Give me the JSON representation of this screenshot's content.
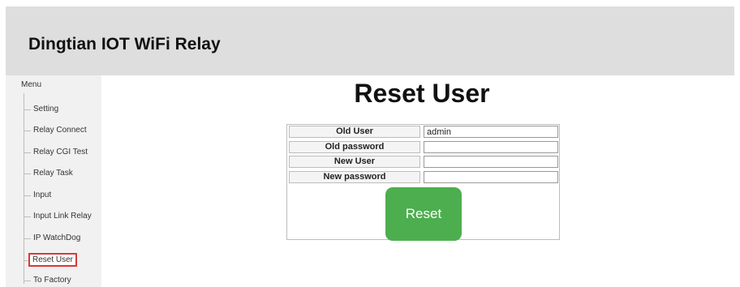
{
  "header": {
    "title": "Dingtian IOT WiFi Relay"
  },
  "sidebar": {
    "title": "Menu",
    "items": [
      {
        "label": "Setting"
      },
      {
        "label": "Relay Connect"
      },
      {
        "label": "Relay CGI Test"
      },
      {
        "label": "Relay Task"
      },
      {
        "label": "Input"
      },
      {
        "label": "Input Link Relay"
      },
      {
        "label": "IP WatchDog"
      },
      {
        "label": "Reset User"
      },
      {
        "label": "To Factory"
      }
    ],
    "active_item": "Reset User"
  },
  "main": {
    "title": "Reset User",
    "form": {
      "old_user_label": "Old User",
      "old_user_value": "admin",
      "old_password_label": "Old password",
      "old_password_value": "",
      "new_user_label": "New User",
      "new_user_value": "",
      "new_password_label": "New password",
      "new_password_value": "",
      "submit_label": "Reset"
    }
  },
  "colors": {
    "header_bg": "#dedede",
    "sidebar_bg": "#f1f1f1",
    "button_green": "#4cae4f",
    "active_outline": "#d63a3a"
  }
}
